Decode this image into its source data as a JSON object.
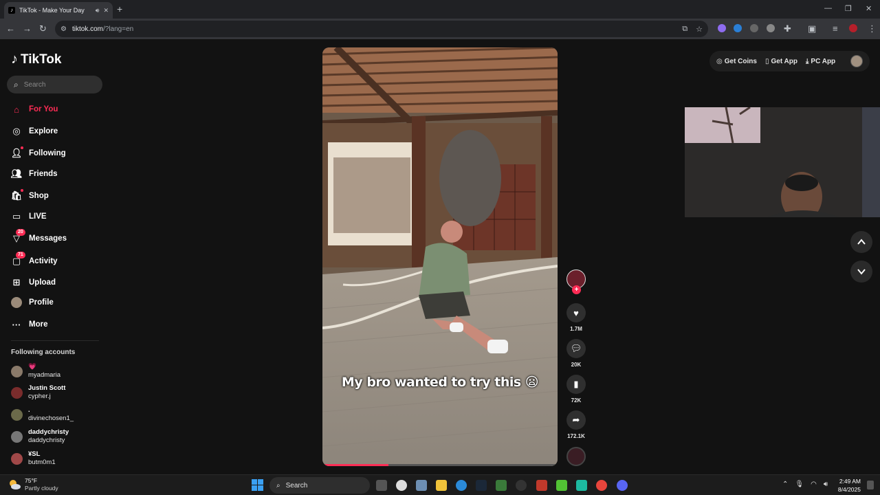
{
  "browser": {
    "tab_title": "TikTok - Make Your Day",
    "url_host": "tiktok.com",
    "url_rest": "/?lang=en"
  },
  "sidebar": {
    "brand": "TikTok",
    "search_placeholder": "Search",
    "nav": [
      {
        "label": "For You",
        "icon": "home-icon",
        "active": true
      },
      {
        "label": "Explore",
        "icon": "compass-icon"
      },
      {
        "label": "Following",
        "icon": "following-icon"
      },
      {
        "label": "Friends",
        "icon": "friends-icon"
      },
      {
        "label": "Shop",
        "icon": "shop-icon"
      },
      {
        "label": "LIVE",
        "icon": "live-icon"
      },
      {
        "label": "Messages",
        "icon": "messages-icon",
        "badge": "20"
      },
      {
        "label": "Activity",
        "icon": "activity-icon",
        "badge": "71"
      },
      {
        "label": "Upload",
        "icon": "upload-icon"
      },
      {
        "label": "Profile",
        "icon": "profile-icon"
      },
      {
        "label": "More",
        "icon": "more-icon"
      }
    ],
    "following_title": "Following accounts",
    "accounts": [
      {
        "display": "💗",
        "handle": "myadmaria"
      },
      {
        "display": "Justin Scott",
        "handle": "cypher.j"
      },
      {
        "display": ".",
        "handle": "divinechosen1_"
      },
      {
        "display": "daddychristy",
        "handle": "daddychristy"
      },
      {
        "display": "¥SL",
        "handle": "butm0m1"
      }
    ]
  },
  "video": {
    "caption": "My bro wanted to try this 😦",
    "progress": 0.28
  },
  "actions": {
    "likes": "1.7M",
    "comments": "20K",
    "saves": "72K",
    "shares": "172.1K"
  },
  "topbar": {
    "get_coins": "Get Coins",
    "get_app": "Get App",
    "pc_app": "PC App"
  },
  "taskbar": {
    "temp": "75°F",
    "weather": "Partly cloudy",
    "search": "Search",
    "time": "2:49 AM",
    "date": "8/4/2025"
  },
  "colors": {
    "accent": "#fe2c55",
    "background": "#121212"
  }
}
